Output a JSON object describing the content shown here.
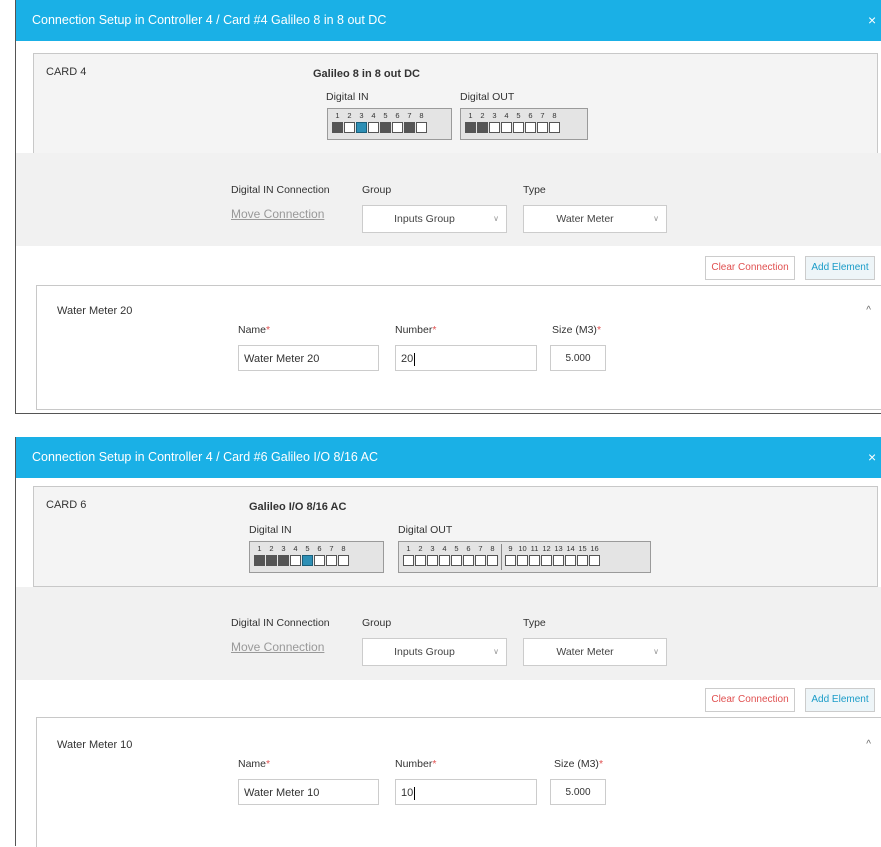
{
  "dialogs": [
    {
      "title": "Connection Setup in Controller 4 / Card #4 Galileo 8 in 8 out DC",
      "close": "×",
      "card_label": "CARD 4",
      "card_model": "Galileo 8 in 8 out DC",
      "digital_in_label": "Digital IN",
      "digital_out_label": "Digital OUT",
      "digital_in": [
        {
          "n": "1",
          "state": "on"
        },
        {
          "n": "2",
          "state": "off"
        },
        {
          "n": "3",
          "state": "sel"
        },
        {
          "n": "4",
          "state": "off"
        },
        {
          "n": "5",
          "state": "on"
        },
        {
          "n": "6",
          "state": "off"
        },
        {
          "n": "7",
          "state": "on"
        },
        {
          "n": "8",
          "state": "off"
        }
      ],
      "digital_out": [
        {
          "n": "1",
          "state": "on"
        },
        {
          "n": "2",
          "state": "on"
        },
        {
          "n": "3",
          "state": "off"
        },
        {
          "n": "4",
          "state": "off"
        },
        {
          "n": "5",
          "state": "off"
        },
        {
          "n": "6",
          "state": "off"
        },
        {
          "n": "7",
          "state": "off"
        },
        {
          "n": "8",
          "state": "off"
        }
      ],
      "connection_label": "Digital IN Connection",
      "move_connection": "Move Connection",
      "group_label": "Group",
      "group_value": "Inputs Group",
      "type_label": "Type",
      "type_value": "Water Meter",
      "clear_connection": "Clear Connection",
      "add_element": "Add Element",
      "element_title": "Water Meter 20",
      "name_label": "Name",
      "number_label": "Number",
      "size_label": "Size (M3)",
      "required_mark": "*",
      "name_value": "Water Meter 20",
      "number_value": "20",
      "size_value": "5.000"
    },
    {
      "title": "Connection Setup in Controller 4 / Card #6 Galileo I/O 8/16 AC",
      "close": "×",
      "card_label": "CARD 6",
      "card_model": "Galileo I/O 8/16 AC",
      "digital_in_label": "Digital IN",
      "digital_out_label": "Digital OUT",
      "digital_in": [
        {
          "n": "1",
          "state": "on"
        },
        {
          "n": "2",
          "state": "on"
        },
        {
          "n": "3",
          "state": "on"
        },
        {
          "n": "4",
          "state": "off"
        },
        {
          "n": "5",
          "state": "sel"
        },
        {
          "n": "6",
          "state": "off"
        },
        {
          "n": "7",
          "state": "off"
        },
        {
          "n": "8",
          "state": "off"
        }
      ],
      "digital_out": [
        {
          "n": "1",
          "state": "off"
        },
        {
          "n": "2",
          "state": "off"
        },
        {
          "n": "3",
          "state": "off"
        },
        {
          "n": "4",
          "state": "off"
        },
        {
          "n": "5",
          "state": "off"
        },
        {
          "n": "6",
          "state": "off"
        },
        {
          "n": "7",
          "state": "off"
        },
        {
          "n": "8",
          "state": "off"
        },
        {
          "n": "9",
          "state": "off"
        },
        {
          "n": "10",
          "state": "off"
        },
        {
          "n": "11",
          "state": "off"
        },
        {
          "n": "12",
          "state": "off"
        },
        {
          "n": "13",
          "state": "off"
        },
        {
          "n": "14",
          "state": "off"
        },
        {
          "n": "15",
          "state": "off"
        },
        {
          "n": "16",
          "state": "off"
        }
      ],
      "connection_label": "Digital IN Connection",
      "move_connection": "Move Connection",
      "group_label": "Group",
      "group_value": "Inputs Group",
      "type_label": "Type",
      "type_value": "Water Meter",
      "clear_connection": "Clear Connection",
      "add_element": "Add Element",
      "element_title": "Water Meter 10",
      "name_label": "Name",
      "number_label": "Number",
      "size_label": "Size (M3)",
      "required_mark": "*",
      "name_value": "Water Meter 10",
      "number_value": "10",
      "size_value": "5.000"
    }
  ]
}
